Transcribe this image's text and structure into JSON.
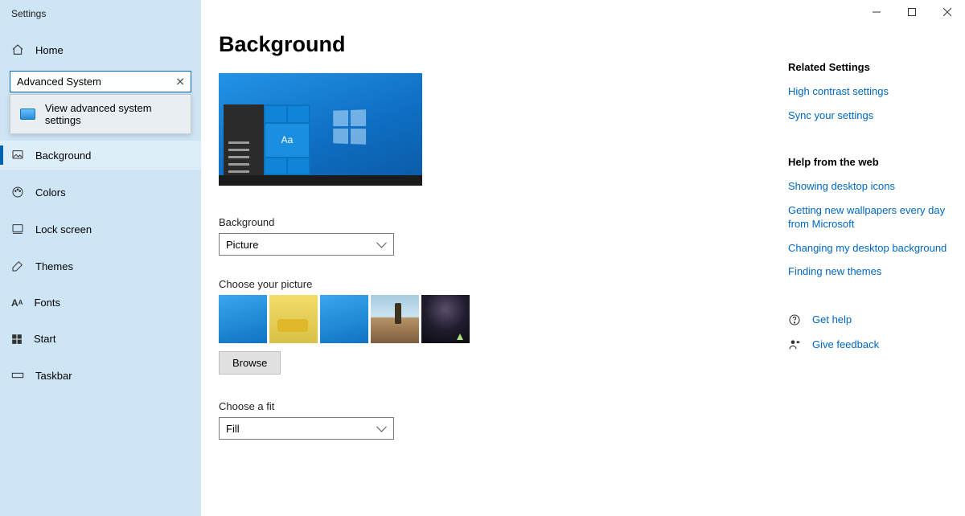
{
  "app_title": "Settings",
  "home_label": "Home",
  "search": {
    "value": "Advanced System",
    "suggestion": "View advanced system settings"
  },
  "nav": [
    {
      "id": "background",
      "label": "Background",
      "active": true
    },
    {
      "id": "colors",
      "label": "Colors"
    },
    {
      "id": "lockscreen",
      "label": "Lock screen"
    },
    {
      "id": "themes",
      "label": "Themes"
    },
    {
      "id": "fonts",
      "label": "Fonts"
    },
    {
      "id": "start",
      "label": "Start"
    },
    {
      "id": "taskbar",
      "label": "Taskbar"
    }
  ],
  "page_title": "Background",
  "preview_tile_text": "Aa",
  "background_section": {
    "label": "Background",
    "value": "Picture"
  },
  "choose_picture_label": "Choose your picture",
  "browse_label": "Browse",
  "fit_section": {
    "label": "Choose a fit",
    "value": "Fill"
  },
  "right": {
    "related_heading": "Related Settings",
    "related": [
      "High contrast settings",
      "Sync your settings"
    ],
    "help_heading": "Help from the web",
    "help": [
      "Showing desktop icons",
      "Getting new wallpapers every day from Microsoft",
      "Changing my desktop background",
      "Finding new themes"
    ],
    "get_help": "Get help",
    "give_feedback": "Give feedback"
  }
}
